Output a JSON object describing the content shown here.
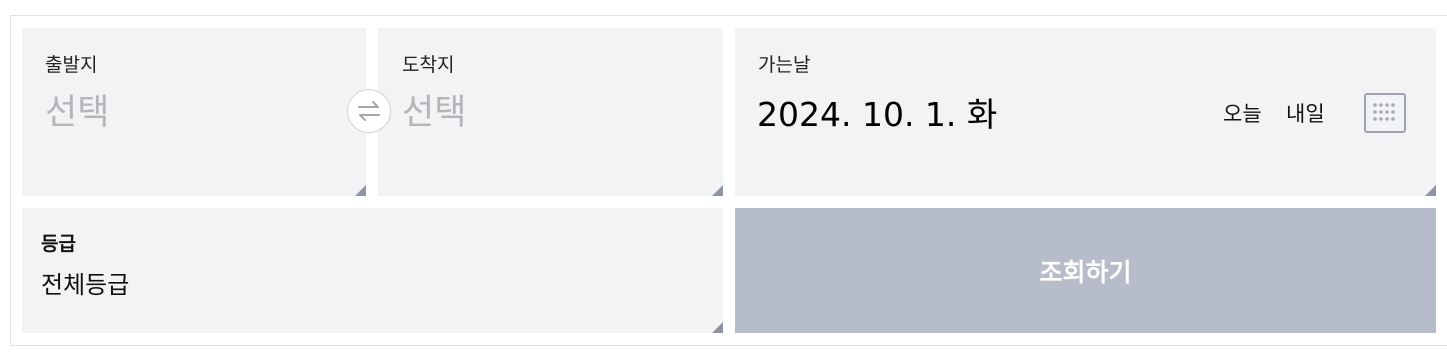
{
  "departure": {
    "label": "출발지",
    "placeholder": "선택"
  },
  "arrival": {
    "label": "도착지",
    "placeholder": "선택"
  },
  "date": {
    "label": "가는날",
    "value": "2024. 10. 1. 화",
    "today": "오늘",
    "tomorrow": "내일"
  },
  "grade": {
    "label": "등급",
    "value": "전체등급"
  },
  "search": {
    "label": "조회하기"
  },
  "icons": {
    "swap": "swap-arrows-icon",
    "calendar": "calendar-icon"
  },
  "colors": {
    "panel": "#f2f3f5",
    "button": "#b7bcca",
    "placeholder": "#b3b5b9"
  }
}
